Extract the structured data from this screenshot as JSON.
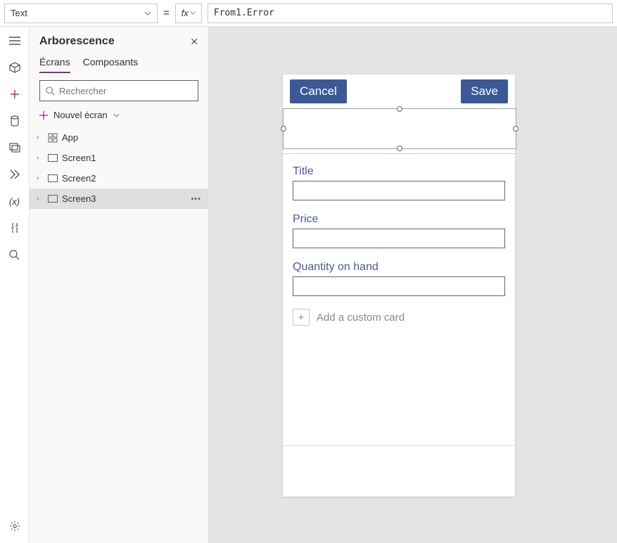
{
  "formula": {
    "property": "Text",
    "fx": "fx",
    "expression": "From1.Error"
  },
  "tree": {
    "title": "Arborescence",
    "tabs": {
      "screens": "Écrans",
      "components": "Composants"
    },
    "search_placeholder": "Rechercher",
    "new_screen": "Nouvel écran",
    "items": [
      "App",
      "Screen1",
      "Screen2",
      "Screen3"
    ],
    "selected_index": 3
  },
  "form": {
    "cancel": "Cancel",
    "save": "Save",
    "cards": [
      {
        "label": "Title"
      },
      {
        "label": "Price"
      },
      {
        "label": "Quantity on hand"
      }
    ],
    "add_card": "Add a custom card"
  }
}
